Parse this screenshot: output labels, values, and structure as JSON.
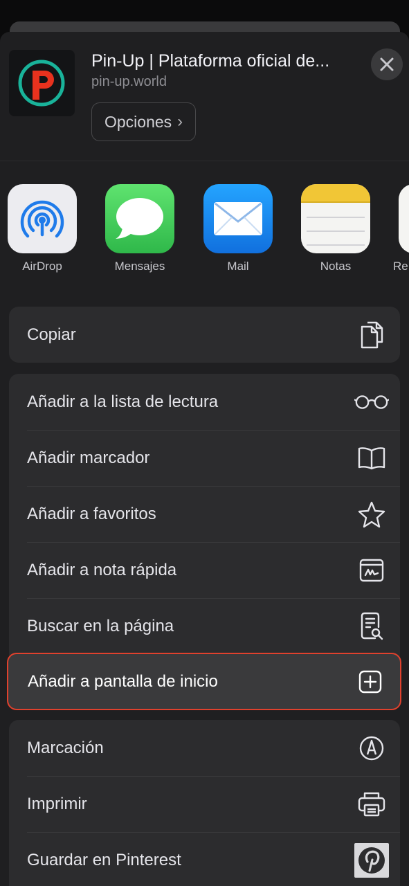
{
  "header": {
    "title": "Pin-Up | Plataforma oficial de...",
    "url": "pin-up.world",
    "options_label": "Opciones",
    "options_chevron": "›"
  },
  "apps": [
    {
      "label": "AirDrop",
      "icon": "airdrop-icon"
    },
    {
      "label": "Mensajes",
      "icon": "messages-icon"
    },
    {
      "label": "Mail",
      "icon": "mail-icon"
    },
    {
      "label": "Notas",
      "icon": "notes-icon"
    },
    {
      "label": "Re",
      "icon": "reminders-icon"
    }
  ],
  "actions": {
    "copy": "Copiar",
    "reading_list": "Añadir a la lista de lectura",
    "bookmark": "Añadir marcador",
    "favorites": "Añadir a favoritos",
    "quick_note": "Añadir a nota rápida",
    "find_on_page": "Buscar en la página",
    "home_screen": "Añadir a pantalla de inicio",
    "markup": "Marcación",
    "print": "Imprimir",
    "pinterest": "Guardar en Pinterest"
  },
  "colors": {
    "sheet": "#1f1f21",
    "group": "#2c2c2e",
    "highlight_border": "#e0412d",
    "messages_green": "#34c759",
    "mail_blue": "#1a82f0"
  }
}
